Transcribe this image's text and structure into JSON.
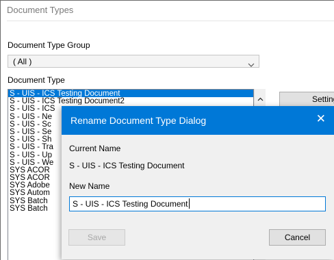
{
  "window": {
    "title": "Document Types"
  },
  "form": {
    "group_label": "Document Type Group",
    "group_value": "( All )",
    "type_label": "Document Type",
    "settings_label": "Settings"
  },
  "list": {
    "items": [
      "S - UIS - ICS Testing Document",
      "S - UIS - ICS Testing Document2",
      "S - UIS - ICS",
      "S - UIS - Ne",
      "S - UIS - Sc",
      "S - UIS - Se",
      "S - UIS - Sh",
      "S - UIS - Tra",
      "S - UIS - Up",
      "S - UIS - We",
      "SYS ACOR",
      "SYS ACOR",
      "SYS Adobe",
      "SYS Autom",
      "SYS Batch",
      "SYS Batch"
    ],
    "selected_index": 0
  },
  "dialog": {
    "title": "Rename Document Type  Dialog",
    "close_glyph": "✕",
    "current_name_label": "Current Name",
    "current_name_value": "S - UIS - ICS Testing Document",
    "new_name_label": "New Name",
    "new_name_value": "S - UIS - ICS Testing Document",
    "save_label": "Save",
    "cancel_label": "Cancel"
  },
  "colors": {
    "accent": "#0078d7",
    "selection": "#0078d7",
    "disabled_text": "#a8a8a8"
  }
}
